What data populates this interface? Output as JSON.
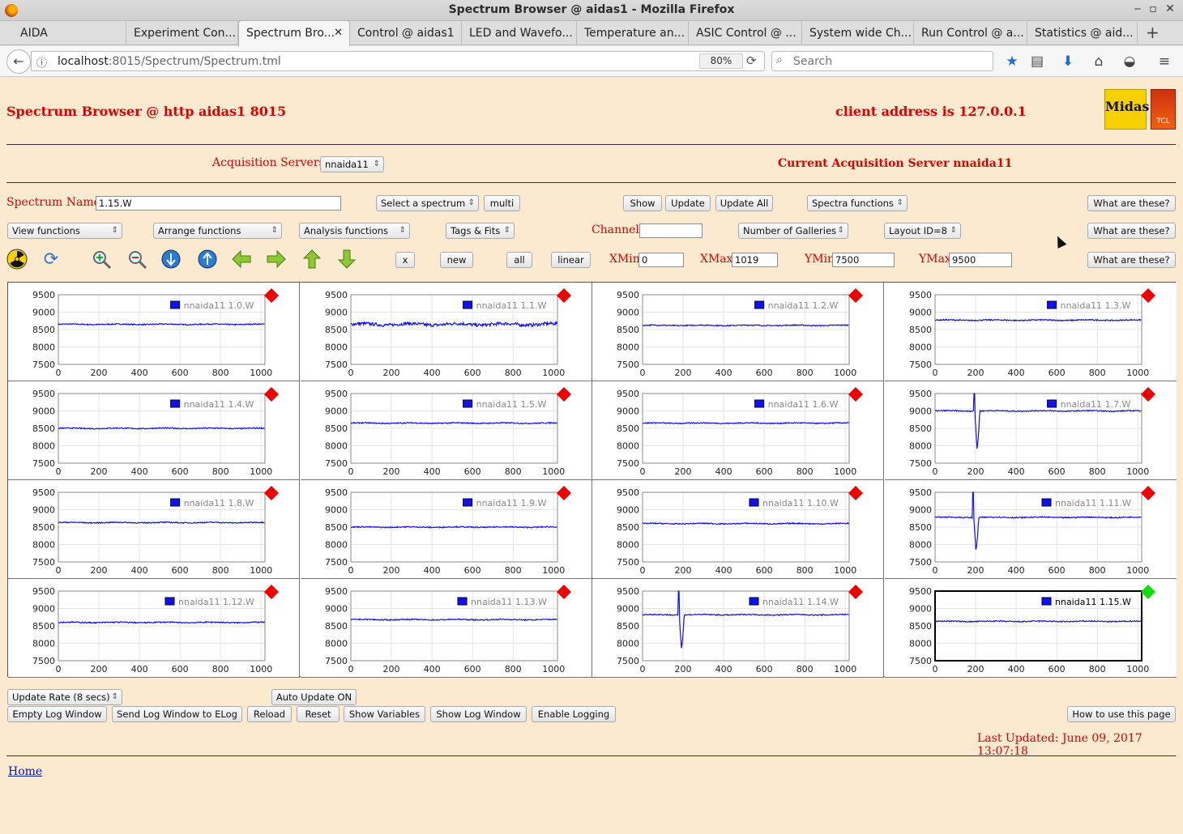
{
  "window": {
    "title": "Spectrum Browser @ aidas1 - Mozilla Firefox"
  },
  "tabs": [
    {
      "label": "AIDA",
      "active": false
    },
    {
      "label": "Experiment Con...",
      "active": false
    },
    {
      "label": "Spectrum Bro...",
      "active": true
    },
    {
      "label": "Control @ aidas1",
      "active": false
    },
    {
      "label": "LED and Wavefo...",
      "active": false
    },
    {
      "label": "Temperature an...",
      "active": false
    },
    {
      "label": "ASIC Control @ ...",
      "active": false
    },
    {
      "label": "System wide Ch...",
      "active": false
    },
    {
      "label": "Run Control @ a...",
      "active": false
    },
    {
      "label": "Statistics @ aid...",
      "active": false
    }
  ],
  "navbar": {
    "url_host": "localhost",
    "url_path": ":8015/Spectrum/Spectrum.tml",
    "zoom": "80%",
    "search_placeholder": "Search"
  },
  "header": {
    "title": "Spectrum Browser @ http aidas1 8015",
    "client": "client address is 127.0.0.1",
    "midas_logo": "Midas",
    "tcl_logo": "TCL"
  },
  "acquisition": {
    "label": "Acquisition Servers",
    "selected": "nnaida11",
    "current": "Current Acquisition Server nnaida11"
  },
  "controls": {
    "spectrum_name_label": "Spectrum Name:",
    "spectrum_name_value": "1.15.W",
    "select_spectrum": "Select a spectrum",
    "multi": "multi",
    "show": "Show",
    "update": "Update",
    "update_all": "Update All",
    "spectra_functions": "Spectra functions",
    "what_are_these": "What are these?",
    "view_functions": "View functions",
    "arrange_functions": "Arrange functions",
    "analysis_functions": "Analysis functions",
    "tags_fits": "Tags & Fits",
    "channel_label": "Channel:",
    "channel_value": "",
    "galleries": "Number of Galleries",
    "layout": "Layout ID=8",
    "x": "x",
    "new": "new",
    "all": "all",
    "linear": "linear",
    "xmin_label": "XMin",
    "xmin": "0",
    "xmax_label": "XMax",
    "xmax": "1019",
    "ymin_label": "YMin",
    "ymin": "7500",
    "ymax_label": "YMax",
    "ymax": "9500"
  },
  "toolbar_icons": [
    "radiation-icon",
    "refresh-icon",
    "zoom-in-icon",
    "zoom-out-icon",
    "expand-down-icon",
    "expand-up-icon",
    "arrow-left-icon",
    "arrow-right-icon",
    "arrow-up-icon",
    "arrow-down-icon"
  ],
  "colors": {
    "page_bg": "#fbe9d0",
    "accent_red": "#e00000",
    "trace_blue": "#1111ee",
    "marker_red": "#ee0000",
    "marker_green": "#11dd11"
  },
  "chart_data": [
    {
      "type": "line",
      "series": [
        {
          "name": "nnaida11 1.0.W",
          "baseline": 8650,
          "noise": "low"
        }
      ],
      "marker": "red",
      "x_ticks": [
        "0",
        "200",
        "400",
        "600",
        "800",
        "1000"
      ],
      "y_ticks": [
        "9500",
        "9000",
        "8500",
        "8000",
        "7500"
      ],
      "xlim": [
        0,
        1019
      ],
      "ylim": [
        7500,
        9500
      ]
    },
    {
      "type": "line",
      "series": [
        {
          "name": "nnaida11 1.1.W",
          "baseline": 8650,
          "noise": "high"
        }
      ],
      "marker": "red",
      "x_ticks": [
        "0",
        "200",
        "400",
        "600",
        "800",
        "1000"
      ],
      "y_ticks": [
        "9500",
        "9000",
        "8500",
        "8000",
        "7500"
      ],
      "xlim": [
        0,
        1019
      ],
      "ylim": [
        7500,
        9500
      ]
    },
    {
      "type": "line",
      "series": [
        {
          "name": "nnaida11 1.2.W",
          "baseline": 8620,
          "noise": "low"
        }
      ],
      "marker": "red",
      "x_ticks": [
        "0",
        "200",
        "400",
        "600",
        "800",
        "1000"
      ],
      "y_ticks": [
        "9500",
        "9000",
        "8500",
        "8000",
        "7500"
      ],
      "xlim": [
        0,
        1019
      ],
      "ylim": [
        7500,
        9500
      ]
    },
    {
      "type": "line",
      "series": [
        {
          "name": "nnaida11 1.3.W",
          "baseline": 8770,
          "noise": "low"
        }
      ],
      "marker": "red",
      "x_ticks": [
        "0",
        "200",
        "400",
        "600",
        "800",
        "1000"
      ],
      "y_ticks": [
        "9500",
        "9000",
        "8500",
        "8000",
        "7500"
      ],
      "xlim": [
        0,
        1019
      ],
      "ylim": [
        7500,
        9500
      ]
    },
    {
      "type": "line",
      "series": [
        {
          "name": "nnaida11 1.4.W",
          "baseline": 8500,
          "noise": "low"
        }
      ],
      "marker": "red",
      "x_ticks": [
        "0",
        "200",
        "400",
        "600",
        "800",
        "1000"
      ],
      "y_ticks": [
        "9500",
        "9000",
        "8500",
        "8000",
        "7500"
      ],
      "xlim": [
        0,
        1019
      ],
      "ylim": [
        7500,
        9500
      ]
    },
    {
      "type": "line",
      "series": [
        {
          "name": "nnaida11 1.5.W",
          "baseline": 8650,
          "noise": "low"
        }
      ],
      "marker": "red",
      "x_ticks": [
        "0",
        "200",
        "400",
        "600",
        "800",
        "1000"
      ],
      "y_ticks": [
        "9500",
        "9000",
        "8500",
        "8000",
        "7500"
      ],
      "xlim": [
        0,
        1019
      ],
      "ylim": [
        7500,
        9500
      ]
    },
    {
      "type": "line",
      "series": [
        {
          "name": "nnaida11 1.6.W",
          "baseline": 8650,
          "noise": "low"
        }
      ],
      "marker": "red",
      "x_ticks": [
        "0",
        "200",
        "400",
        "600",
        "800",
        "1000"
      ],
      "y_ticks": [
        "9500",
        "9000",
        "8500",
        "8000",
        "7500"
      ],
      "xlim": [
        0,
        1019
      ],
      "ylim": [
        7500,
        9500
      ]
    },
    {
      "type": "line",
      "series": [
        {
          "name": "nnaida11 1.7.W",
          "baseline": 9000,
          "noise": "low",
          "spike_at": 190,
          "dip_to": 7900
        }
      ],
      "marker": "red",
      "x_ticks": [
        "0",
        "200",
        "400",
        "600",
        "800",
        "1000"
      ],
      "y_ticks": [
        "9500",
        "9000",
        "8500",
        "8000",
        "7500"
      ],
      "xlim": [
        0,
        1019
      ],
      "ylim": [
        7500,
        9500
      ]
    },
    {
      "type": "line",
      "series": [
        {
          "name": "nnaida11 1.8.W",
          "baseline": 8630,
          "noise": "low"
        }
      ],
      "marker": "red",
      "x_ticks": [
        "0",
        "200",
        "400",
        "600",
        "800",
        "1000"
      ],
      "y_ticks": [
        "9500",
        "9000",
        "8500",
        "8000",
        "7500"
      ],
      "xlim": [
        0,
        1019
      ],
      "ylim": [
        7500,
        9500
      ]
    },
    {
      "type": "line",
      "series": [
        {
          "name": "nnaida11 1.9.W",
          "baseline": 8500,
          "noise": "low"
        }
      ],
      "marker": "red",
      "x_ticks": [
        "0",
        "200",
        "400",
        "600",
        "800",
        "1000"
      ],
      "y_ticks": [
        "9500",
        "9000",
        "8500",
        "8000",
        "7500"
      ],
      "xlim": [
        0,
        1019
      ],
      "ylim": [
        7500,
        9500
      ]
    },
    {
      "type": "line",
      "series": [
        {
          "name": "nnaida11 1.10.W",
          "baseline": 8600,
          "noise": "low"
        }
      ],
      "marker": "red",
      "x_ticks": [
        "0",
        "200",
        "400",
        "600",
        "800",
        "1000"
      ],
      "y_ticks": [
        "9500",
        "9000",
        "8500",
        "8000",
        "7500"
      ],
      "xlim": [
        0,
        1019
      ],
      "ylim": [
        7500,
        9500
      ]
    },
    {
      "type": "line",
      "series": [
        {
          "name": "nnaida11 1.11.W",
          "baseline": 8780,
          "noise": "low",
          "spike_at": 185,
          "dip_to": 7850
        }
      ],
      "marker": "red",
      "x_ticks": [
        "0",
        "200",
        "400",
        "600",
        "800",
        "1000"
      ],
      "y_ticks": [
        "9500",
        "9000",
        "8500",
        "8000",
        "7500"
      ],
      "xlim": [
        0,
        1019
      ],
      "ylim": [
        7500,
        9500
      ]
    },
    {
      "type": "line",
      "series": [
        {
          "name": "nnaida11 1.12.W",
          "baseline": 8600,
          "noise": "low"
        }
      ],
      "marker": "red",
      "x_ticks": [
        "0",
        "200",
        "400",
        "600",
        "800",
        "1000"
      ],
      "y_ticks": [
        "9500",
        "9000",
        "8500",
        "8000",
        "7500"
      ],
      "xlim": [
        0,
        1019
      ],
      "ylim": [
        7500,
        9500
      ]
    },
    {
      "type": "line",
      "series": [
        {
          "name": "nnaida11 1.13.W",
          "baseline": 8680,
          "noise": "low"
        }
      ],
      "marker": "red",
      "x_ticks": [
        "0",
        "200",
        "400",
        "600",
        "800",
        "1000"
      ],
      "y_ticks": [
        "9500",
        "9000",
        "8500",
        "8000",
        "7500"
      ],
      "xlim": [
        0,
        1019
      ],
      "ylim": [
        7500,
        9500
      ]
    },
    {
      "type": "line",
      "series": [
        {
          "name": "nnaida11 1.14.W",
          "baseline": 8820,
          "noise": "low",
          "spike_at": 175,
          "dip_to": 7850
        }
      ],
      "marker": "red",
      "x_ticks": [
        "0",
        "200",
        "400",
        "600",
        "800",
        "1000"
      ],
      "y_ticks": [
        "9500",
        "9000",
        "8500",
        "8000",
        "7500"
      ],
      "xlim": [
        0,
        1019
      ],
      "ylim": [
        7500,
        9500
      ]
    },
    {
      "type": "line",
      "series": [
        {
          "name": "nnaida11 1.15.W",
          "baseline": 8630,
          "noise": "low"
        }
      ],
      "marker": "green",
      "selected": true,
      "x_ticks": [
        "0",
        "200",
        "400",
        "600",
        "800",
        "1000"
      ],
      "y_ticks": [
        "9500",
        "9000",
        "8500",
        "8000",
        "7500"
      ],
      "xlim": [
        0,
        1019
      ],
      "ylim": [
        7500,
        9500
      ]
    }
  ],
  "bottom": {
    "update_rate": "Update Rate (8 secs)",
    "auto_update": "Auto Update ON",
    "empty_log": "Empty Log Window",
    "send_log": "Send Log Window to ELog",
    "reload": "Reload",
    "reset": "Reset",
    "show_variables": "Show Variables",
    "show_log": "Show Log Window",
    "enable_logging": "Enable Logging",
    "how_to": "How to use this page",
    "last_updated": "Last Updated: June 09, 2017 13:07:18",
    "home": "Home"
  }
}
